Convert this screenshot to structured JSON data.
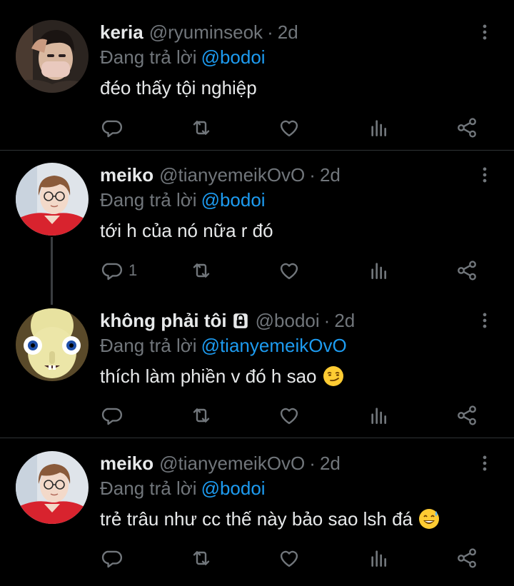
{
  "colors": {
    "background": "#000000",
    "text": "#e7e9ea",
    "muted": "#71767b",
    "mention": "#1d9bf0",
    "divider": "#2f3336"
  },
  "tweets": [
    {
      "name": "keria",
      "handle": "@ryuminseok",
      "dot": "·",
      "time": "2d",
      "reply_prefix": "Đang trả lời",
      "reply_to": "@bodoi",
      "text": "đéo thấy tội nghiệp",
      "reply_count": "",
      "avatar": "avatar-keria"
    },
    {
      "name": "meiko",
      "handle": "@tianyemeikOvO",
      "dot": "·",
      "time": "2d",
      "reply_prefix": "Đang trả lời",
      "reply_to": "@bodoi",
      "text": "tới h của nó nữa r đó",
      "reply_count": "1",
      "avatar": "avatar-meiko"
    },
    {
      "name": "không phải tôi",
      "handle": "@bodoi",
      "dot": "·",
      "time": "2d",
      "reply_prefix": "Đang trả lời",
      "reply_to": "@tianyemeikOvO",
      "text": "thích làm phiền v đó h sao",
      "reply_count": "",
      "protected_icon": "lock-icon",
      "emoji": "smirking-face-emoji",
      "avatar": "avatar-rabbid"
    },
    {
      "name": "meiko",
      "handle": "@tianyemeikOvO",
      "dot": "·",
      "time": "2d",
      "reply_prefix": "Đang trả lời",
      "reply_to": "@bodoi",
      "text": "trẻ trâu như cc thế này bảo sao lsh đá",
      "reply_count": "",
      "emoji": "grinning-face-with-sweat-emoji",
      "avatar": "avatar-meiko"
    }
  ],
  "icons": {
    "more": "more-vertical-icon",
    "reply": "reply-icon",
    "retweet": "retweet-icon",
    "like": "like-icon",
    "analytics": "analytics-icon",
    "share": "share-icon"
  }
}
